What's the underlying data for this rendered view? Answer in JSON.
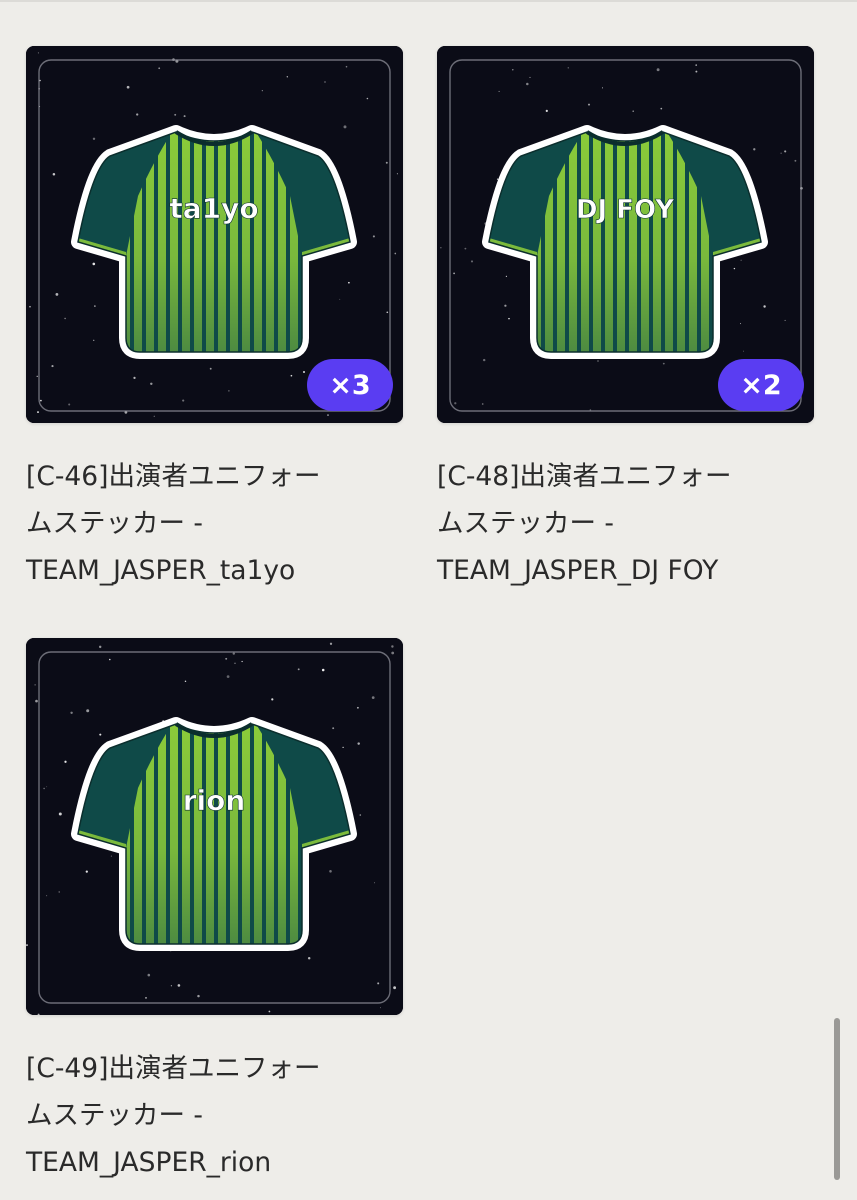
{
  "products": [
    {
      "jersey_name": "ta1yo",
      "badge": "×3",
      "title_lines": [
        "[C-46]出演者ユニフォー",
        "ムステッカー -",
        "TEAM_JASPER_ta1yo"
      ]
    },
    {
      "jersey_name": "DJ FOY",
      "badge": "×2",
      "title_lines": [
        "[C-48]出演者ユニフォー",
        "ムステッカー -",
        "TEAM_JASPER_DJ FOY"
      ]
    },
    {
      "jersey_name": "rion",
      "badge": "",
      "title_lines": [
        "[C-49]出演者ユニフォー",
        "ムステッカー -",
        "TEAM_JASPER_rion"
      ]
    }
  ],
  "colors": {
    "jersey_stripe_light": "#8ccc3a",
    "jersey_stripe_dark": "#0f4a48",
    "sleeve": "#0f4a48",
    "badge_bg": "#5a3df2",
    "thumb_bg": "#0b0c17"
  }
}
